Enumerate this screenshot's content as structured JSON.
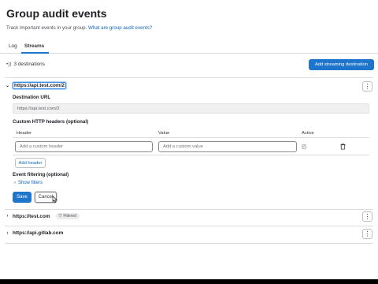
{
  "page": {
    "title": "Group audit events",
    "subtitle_text": "Track important events in your group.",
    "subtitle_link": "What are group audit events?"
  },
  "tabs": [
    {
      "label": "Log",
      "active": false
    },
    {
      "label": "Streams",
      "active": true
    }
  ],
  "streams_summary": {
    "icon": "stream-icon",
    "count_label": "3 destinations",
    "add_button_label": "Add streaming destination"
  },
  "expanded_stream": {
    "name": "https://api.test.com/2",
    "destination_url_label": "Destination URL",
    "destination_url_value": "https://api.test.com/2",
    "headers_label": "Custom HTTP headers (optional)",
    "columns": {
      "header": "Header",
      "value": "Value",
      "active": "Active"
    },
    "header_placeholder": "Add a custom header",
    "value_placeholder": "Add a custom value",
    "active_checked": true,
    "add_header_label": "Add header",
    "event_filtering_label": "Event filtering (optional)",
    "show_filters_label": "Show filters",
    "save_label": "Save",
    "cancel_label": "Cancel"
  },
  "collapsed_streams": [
    {
      "name": "https://test.com",
      "badge": "Filtered"
    },
    {
      "name": "https://api.gitlab.com",
      "badge": ""
    }
  ],
  "colors": {
    "primary": "#1f75cb",
    "link": "#1068bf",
    "border": "#dcdcde"
  }
}
